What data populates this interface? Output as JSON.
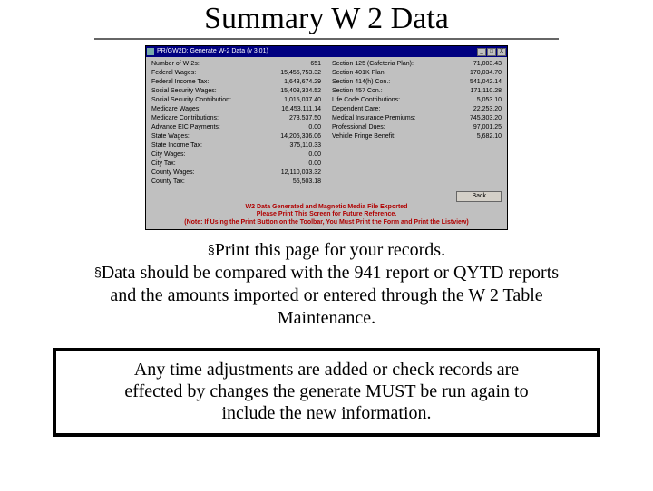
{
  "title": "Summary W 2 Data",
  "window": {
    "caption": "PR/GW2D: Generate W-2 Data (v 3.01)",
    "buttons": {
      "min": "_",
      "max": "□",
      "close": "X"
    },
    "left": [
      {
        "label": "Number of W-2s:",
        "value": "651"
      },
      {
        "label": "Federal Wages:",
        "value": "15,455,753.32"
      },
      {
        "label": "Federal Income Tax:",
        "value": "1,643,674.29"
      },
      {
        "label": "Social Security Wages:",
        "value": "15,403,334.52"
      },
      {
        "label": "Social Security Contribution:",
        "value": "1,015,037.40"
      },
      {
        "label": "Medicare Wages:",
        "value": "16,453,111.14"
      },
      {
        "label": "Medicare Contributions:",
        "value": "273,537.50"
      },
      {
        "label": "Advance EIC Payments:",
        "value": "0.00"
      },
      {
        "label": "State Wages:",
        "value": "14,205,336.06"
      },
      {
        "label": "State Income Tax:",
        "value": "375,110.33"
      },
      {
        "label": "City Wages:",
        "value": "0.00"
      },
      {
        "label": "City Tax:",
        "value": "0.00"
      },
      {
        "label": "County Wages:",
        "value": "12,110,033.32"
      },
      {
        "label": "County Tax:",
        "value": "55,503.18"
      }
    ],
    "right": [
      {
        "label": "Section 125 (Cafeteria Plan):",
        "value": "71,003.43"
      },
      {
        "label": "Section 401K Plan:",
        "value": "170,034.70"
      },
      {
        "label": "Section 414(h) Con.:",
        "value": "541,042.14"
      },
      {
        "label": "Section 457 Con.:",
        "value": "171,110.28"
      },
      {
        "label": "Life Code Contributions:",
        "value": "5,053.10"
      },
      {
        "label": "Dependent Care:",
        "value": "22,253.20"
      },
      {
        "label": "Medical Insurance Premiums:",
        "value": "745,303.20"
      },
      {
        "label": "Professional Dues:",
        "value": "97,001.25"
      },
      {
        "label": "Vehicle Fringe Benefit:",
        "value": "5,682.10"
      }
    ],
    "back_label": "Back",
    "footer": [
      "W2 Data Generated and Magnetic Media File Exported",
      "Please Print This Screen for Future Reference.",
      "(Note: If Using the Print Button on the Toolbar, You Must Print the Form and Print the Listview)"
    ]
  },
  "bullets": {
    "mark": "§",
    "b1": "Print this page for your records.",
    "b2a": "Data should be compared with the 941 report or QYTD reports",
    "b2b": "and the amounts imported or entered through the W 2 Table",
    "b2c": "Maintenance."
  },
  "note": {
    "l1": "Any time adjustments are added or check records are",
    "l2": "effected by changes the generate MUST be run again to",
    "l3": "include the new information."
  }
}
